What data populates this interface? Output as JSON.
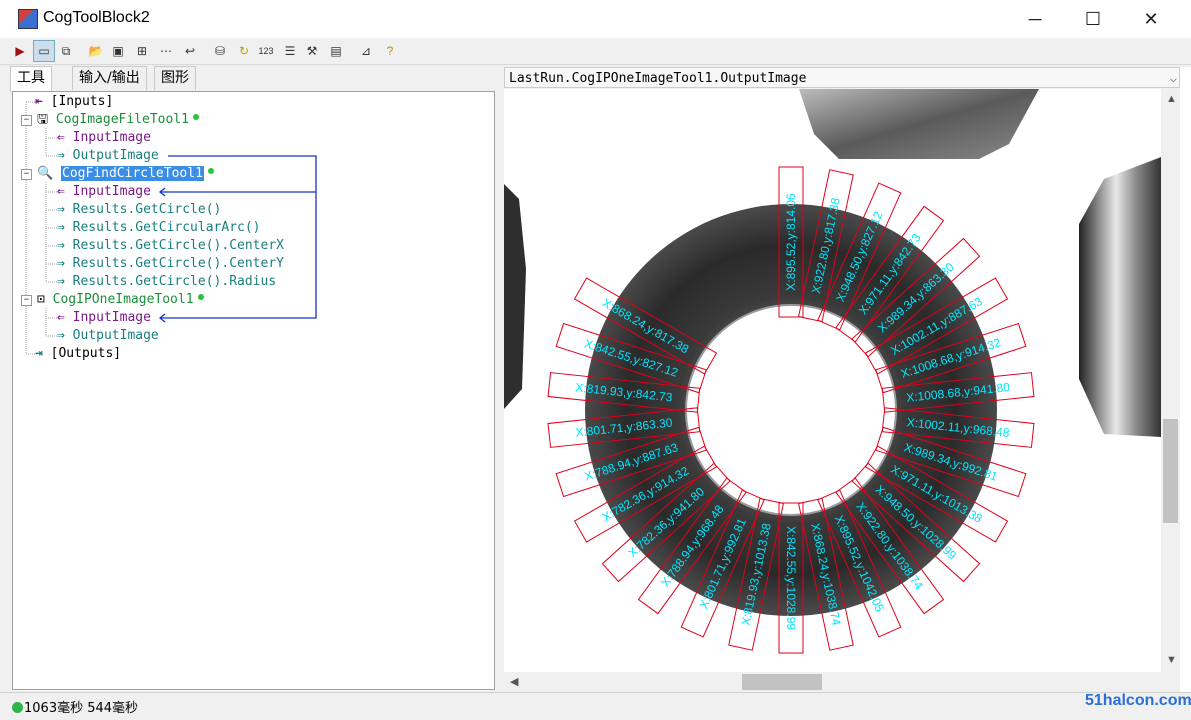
{
  "window": {
    "title": "CogToolBlock2",
    "minimize": "─",
    "maximize": "☐",
    "close": "✕"
  },
  "toolbar": {
    "buttons": [
      "run",
      "show-image",
      "toggle",
      "open",
      "save",
      "properties",
      "network",
      "link",
      "database",
      "reset",
      "counter",
      "table",
      "tools",
      "display",
      "measure",
      "help"
    ]
  },
  "tabs": [
    {
      "label": "工具"
    },
    {
      "label": "输入/输出"
    },
    {
      "label": "图形"
    }
  ],
  "tree": {
    "inputs": "[Inputs]",
    "image_file_tool": "CogImageFileTool1",
    "ift_input": "InputImage",
    "ift_output": "OutputImage",
    "find_circle_tool": "CogFindCircleTool1",
    "fct_input": "InputImage",
    "fct_get_circle": "Results.GetCircle()",
    "fct_get_arc": "Results.GetCircularArc()",
    "fct_center_x": "Results.GetCircle().CenterX",
    "fct_center_y": "Results.GetCircle().CenterY",
    "fct_radius": "Results.GetCircle().Radius",
    "ip_tool": "CogIPOneImageTool1",
    "ip_input": "InputImage",
    "ip_output": "OutputImage",
    "outputs": "[Outputs]"
  },
  "display": {
    "selector": "LastRun.CogIPOneImageTool1.OutputImage"
  },
  "calipers": [
    {
      "label": "X:895.52,y:814.06",
      "angle": -90
    },
    {
      "label": "X:922.80,y:817.38",
      "angle": -78
    },
    {
      "label": "X:948.50,y:827.12",
      "angle": -66
    },
    {
      "label": "X:971.11,y:842.73",
      "angle": -54
    },
    {
      "label": "X:989.34,y:863.30",
      "angle": -42
    },
    {
      "label": "X:1002.11,y:887.63",
      "angle": -30
    },
    {
      "label": "X:1008.68,y:914.32",
      "angle": -18
    },
    {
      "label": "X:1008.68,y:941.80",
      "angle": -6
    },
    {
      "label": "X:1002.11,y:968.48",
      "angle": 6
    },
    {
      "label": "X:989.34,y:992.81",
      "angle": 18
    },
    {
      "label": "X:971.11,y:1013.38",
      "angle": 30
    },
    {
      "label": "X:948.50,y:1028.99",
      "angle": 42
    },
    {
      "label": "X:922.80,y:1038.74",
      "angle": 54
    },
    {
      "label": "X:895.52,y:1042.05",
      "angle": 66
    },
    {
      "label": "X:868.24,y:1038.74",
      "angle": 78
    },
    {
      "label": "X:842.55,y:1028.99",
      "angle": 90
    },
    {
      "label": "X:819.93,y:1013.38",
      "angle": 102
    },
    {
      "label": "X:801.71,y:992.81",
      "angle": 114
    },
    {
      "label": "X:788.94,y:968.48",
      "angle": 126
    },
    {
      "label": "X:782.36,y:941.80",
      "angle": 138
    },
    {
      "label": "X:782.36,y:914.32",
      "angle": 150
    },
    {
      "label": "X:788.94,y:887.63",
      "angle": 162
    },
    {
      "label": "X:801.71,y:863.30",
      "angle": 174
    },
    {
      "label": "X:819.93,y:842.73",
      "angle": 186
    },
    {
      "label": "X:842.55,y:827.12",
      "angle": 198
    },
    {
      "label": "X:868.24,y:817.38",
      "angle": 210
    }
  ],
  "status": {
    "text": "1063毫秒 544毫秒"
  },
  "watermark": "51halcon.com",
  "colors": {
    "caliper": "#e0001b",
    "label": "#00e5ff",
    "tool_text": "#1d8f3a",
    "input_text": "#7a1a8a",
    "output_text": "#1a7f7f",
    "link_line": "#1633c8"
  }
}
